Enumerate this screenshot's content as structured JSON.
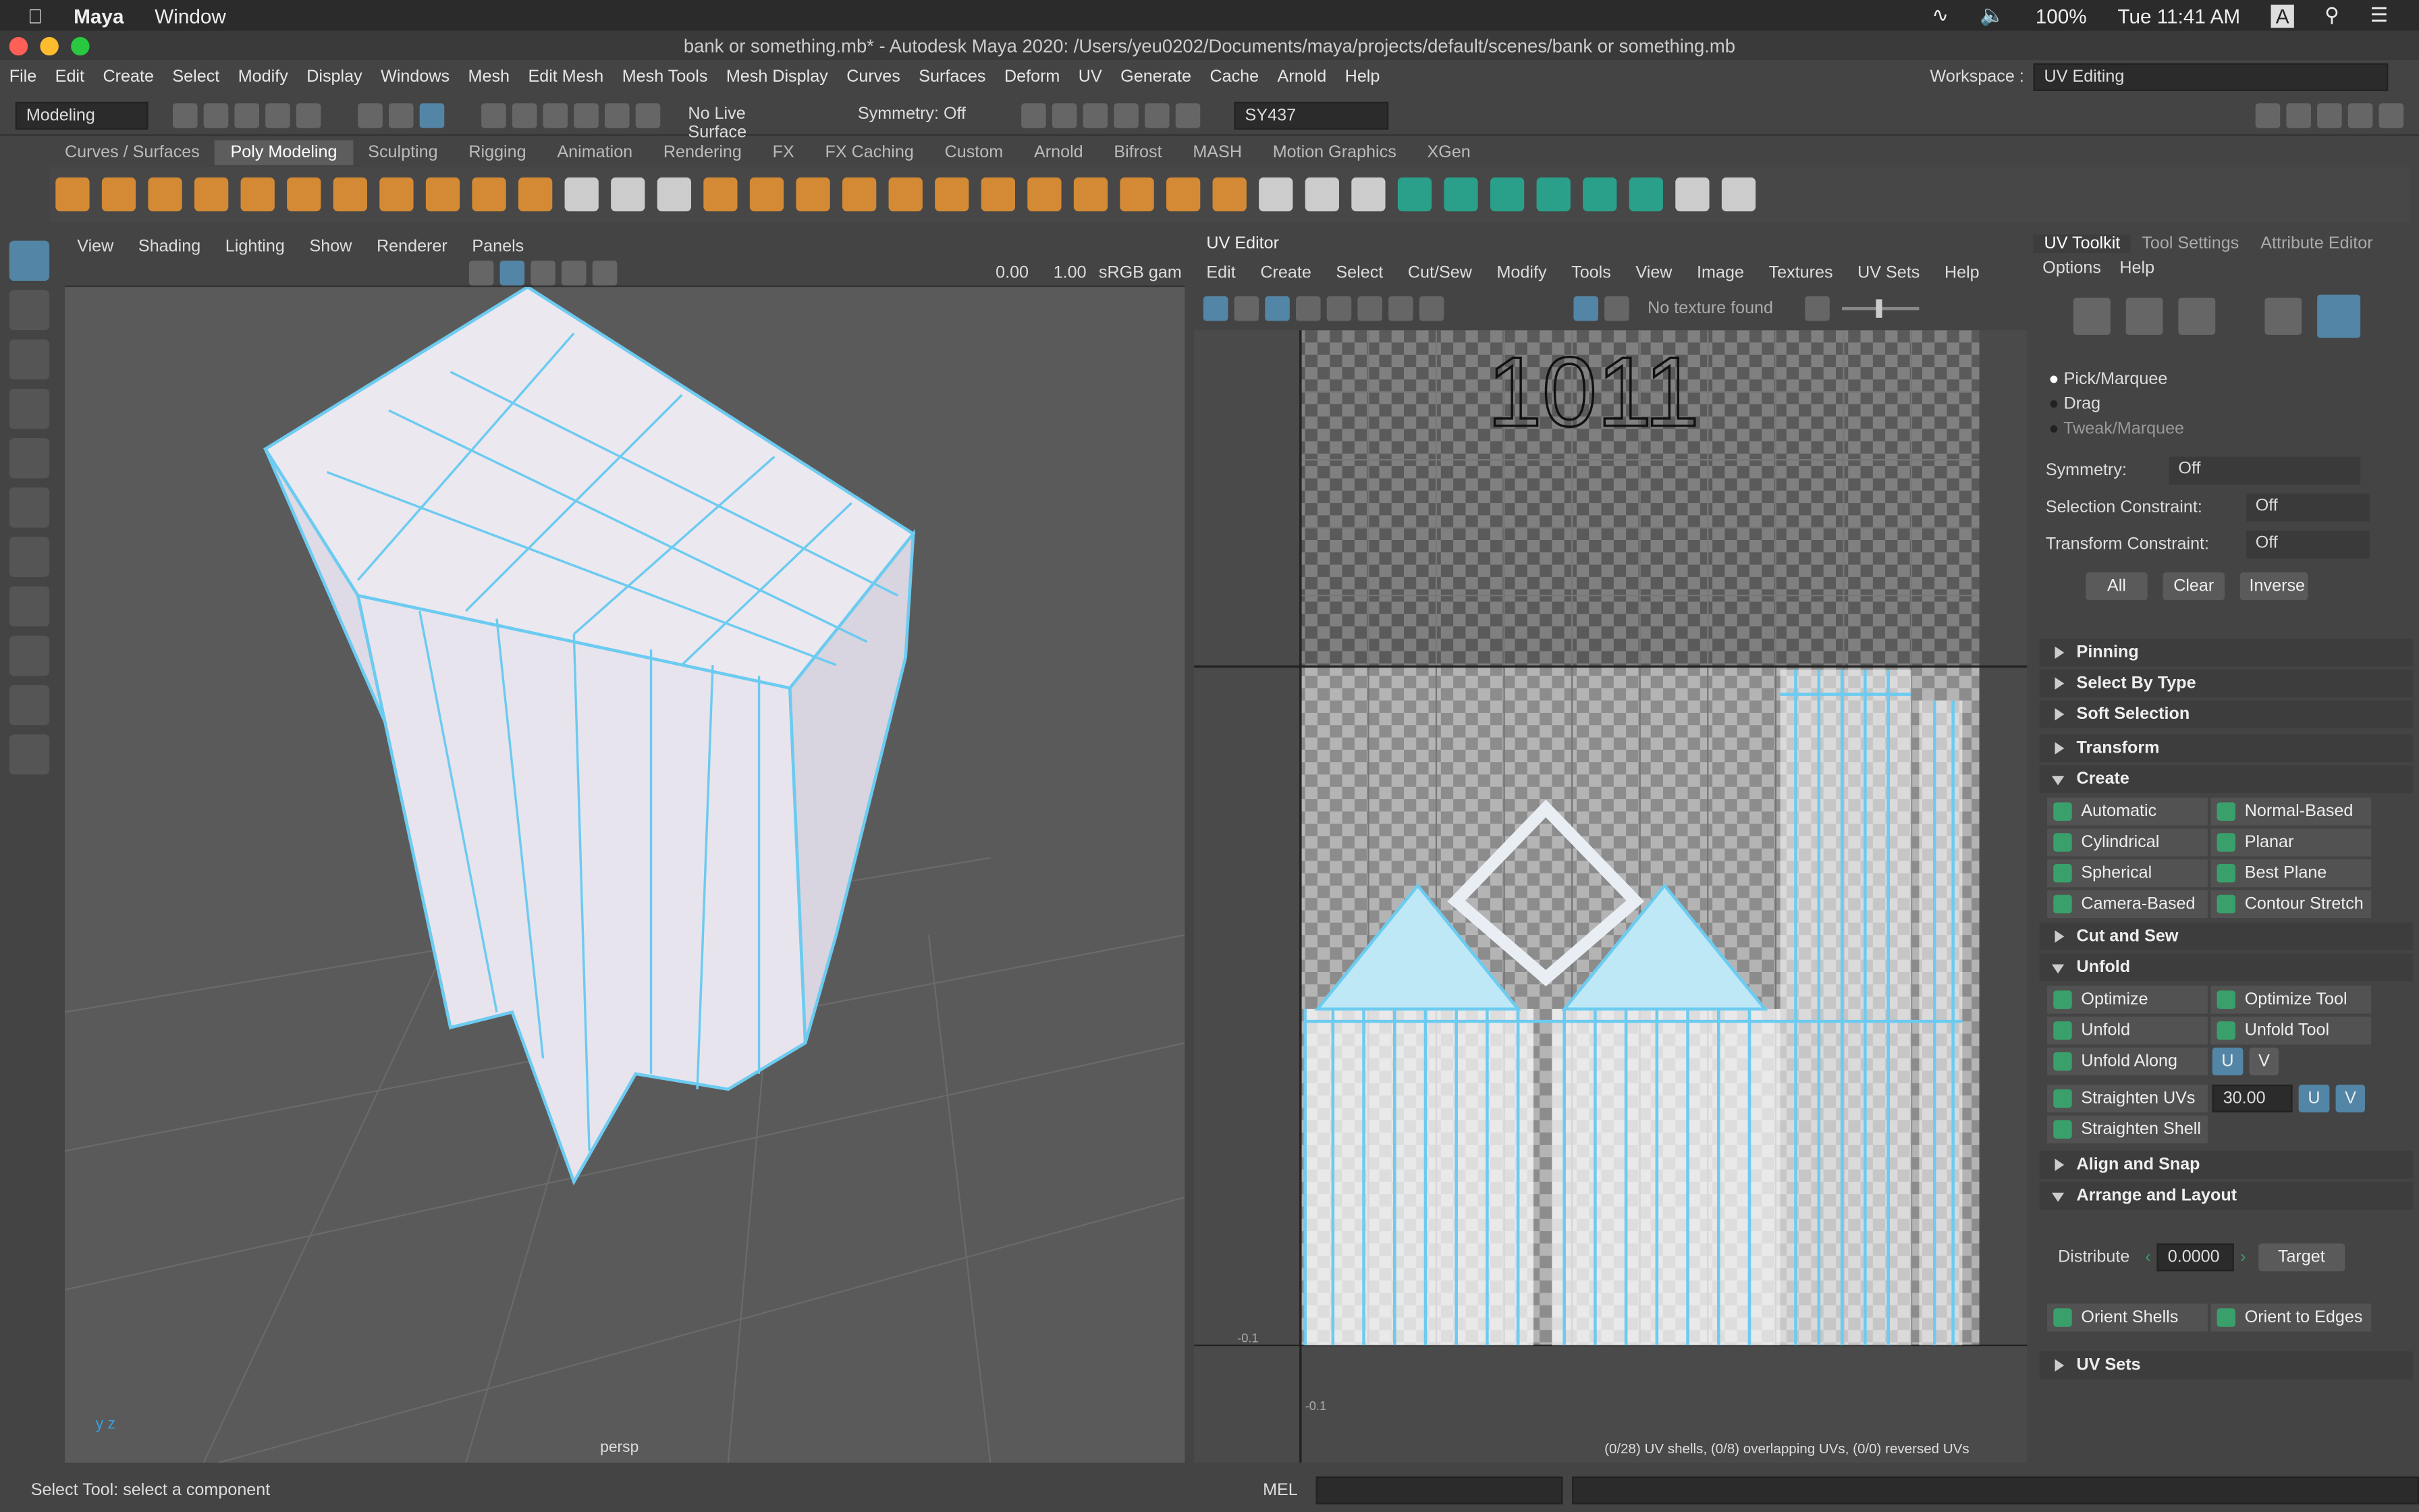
{
  "mac": {
    "app": "Maya",
    "window": "Window",
    "battery": "100%",
    "clock": "Tue 11:41 AM",
    "letter": "A"
  },
  "title": "bank or something.mb* - Autodesk Maya 2020: /Users/yeu0202/Documents/maya/projects/default/scenes/bank or something.mb",
  "menus": [
    "File",
    "Edit",
    "Create",
    "Select",
    "Modify",
    "Display",
    "Windows",
    "Mesh",
    "Edit Mesh",
    "Mesh Tools",
    "Mesh Display",
    "Curves",
    "Surfaces",
    "Deform",
    "UV",
    "Generate",
    "Cache",
    "Arnold",
    "Help"
  ],
  "workspace": {
    "label": "Workspace :",
    "value": "UV Editing"
  },
  "status": {
    "mode": "Modeling",
    "live": "No Live Surface",
    "symmetry": "Symmetry: Off",
    "user": "SY437"
  },
  "shelf_tabs": [
    "Curves / Surfaces",
    "Poly Modeling",
    "Sculpting",
    "Rigging",
    "Animation",
    "Rendering",
    "FX",
    "FX Caching",
    "Custom",
    "Arnold",
    "Bifrost",
    "MASH",
    "Motion Graphics",
    "XGen"
  ],
  "viewport": {
    "menus": [
      "View",
      "Shading",
      "Lighting",
      "Show",
      "Renderer",
      "Panels"
    ],
    "v1": "0.00",
    "v2": "1.00",
    "color": "sRGB gam",
    "camera": "persp"
  },
  "uv": {
    "title": "UV Editor",
    "menus": [
      "Edit",
      "Create",
      "Select",
      "Cut/Sew",
      "Modify",
      "Tools",
      "View",
      "Image",
      "Textures",
      "UV Sets",
      "Help"
    ],
    "texture": "No texture found",
    "tile": "1011",
    "tick1": "-0.1",
    "tick2": "-0.1",
    "info": "(0/28) UV shells, (0/8) overlapping UVs, (0/0) reversed UVs"
  },
  "rp": {
    "tabs": [
      "UV Toolkit",
      "Tool Settings",
      "Attribute Editor"
    ],
    "menus": [
      "Options",
      "Help"
    ],
    "radios": [
      "Pick/Marquee",
      "Drag",
      "Tweak/Marquee"
    ],
    "symmetry": {
      "label": "Symmetry:",
      "value": "Off"
    },
    "selc": {
      "label": "Selection Constraint:",
      "value": "Off"
    },
    "trc": {
      "label": "Transform Constraint:",
      "value": "Off"
    },
    "btns": [
      "All",
      "Clear",
      "Inverse"
    ],
    "sec1": [
      "Pinning",
      "Select By Type",
      "Soft Selection"
    ],
    "transform": "Transform",
    "create": "Create",
    "create_btns": [
      "Automatic",
      "Normal-Based",
      "Cylindrical",
      "Planar",
      "Spherical",
      "Best Plane",
      "Camera-Based",
      "Contour Stretch"
    ],
    "cutsew": "Cut and Sew",
    "unfold": "Unfold",
    "unfold_btns": [
      "Optimize",
      "Optimize Tool",
      "Unfold",
      "Unfold Tool"
    ],
    "unfold_along": "Unfold Along",
    "u": "U",
    "v": "V",
    "straighten": "Straighten UVs",
    "straighten_val": "30.00",
    "straighten_shell": "Straighten Shell",
    "align": "Align and Snap",
    "arrange": "Arrange and Layout",
    "distribute": "Distribute",
    "dist_val": "0.0000",
    "target": "Target",
    "orient": [
      "Orient Shells",
      "Orient to Edges"
    ],
    "uvsets": "UV Sets"
  },
  "bottom": {
    "help": "Select Tool: select a component",
    "mel": "MEL"
  }
}
